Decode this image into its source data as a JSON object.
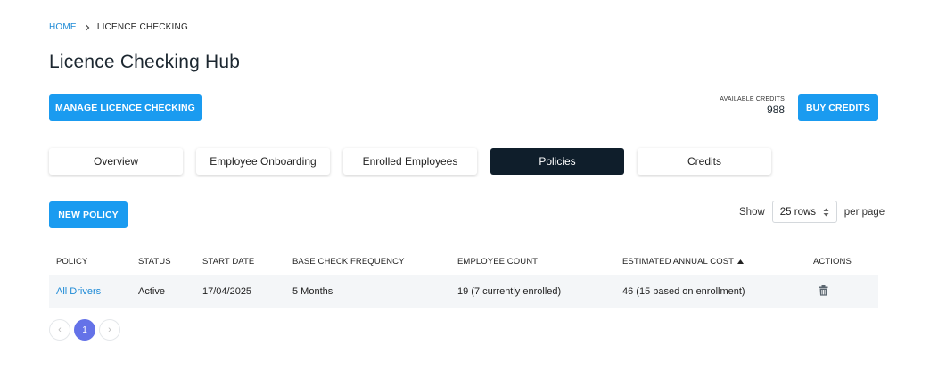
{
  "breadcrumb": {
    "home": "HOME",
    "current": "LICENCE CHECKING"
  },
  "page_title": "Licence Checking Hub",
  "manage_button": "MANAGE LICENCE CHECKING",
  "credits": {
    "label": "AVAILABLE CREDITS",
    "value": "988",
    "buy_button": "BUY CREDITS"
  },
  "tabs": [
    {
      "label": "Overview"
    },
    {
      "label": "Employee Onboarding"
    },
    {
      "label": "Enrolled Employees"
    },
    {
      "label": "Policies",
      "active": true
    },
    {
      "label": "Credits"
    }
  ],
  "new_policy_button": "NEW POLICY",
  "rows_control": {
    "show": "Show",
    "selected": "25 rows",
    "per_page": "per page"
  },
  "table": {
    "columns": [
      "POLICY",
      "STATUS",
      "START DATE",
      "BASE CHECK FREQUENCY",
      "EMPLOYEE COUNT",
      "ESTIMATED ANNUAL COST",
      "ACTIONS"
    ],
    "sorted_column_icon": "sort-ascending-icon",
    "rows": [
      {
        "policy": "All Drivers",
        "status": "Active",
        "start_date": "17/04/2025",
        "frequency": "5 Months",
        "employee_count": "19 (7 currently enrolled)",
        "annual_cost": "46 (15 based on enrollment)",
        "action_icon": "trash-icon"
      }
    ]
  },
  "pagination": {
    "prev": "‹",
    "current": "1",
    "next": "›"
  },
  "colors": {
    "accent": "#1a9bf0",
    "active_tab": "#0f1e2b",
    "link": "#1d8ad6",
    "pager_active": "#6472e8"
  }
}
